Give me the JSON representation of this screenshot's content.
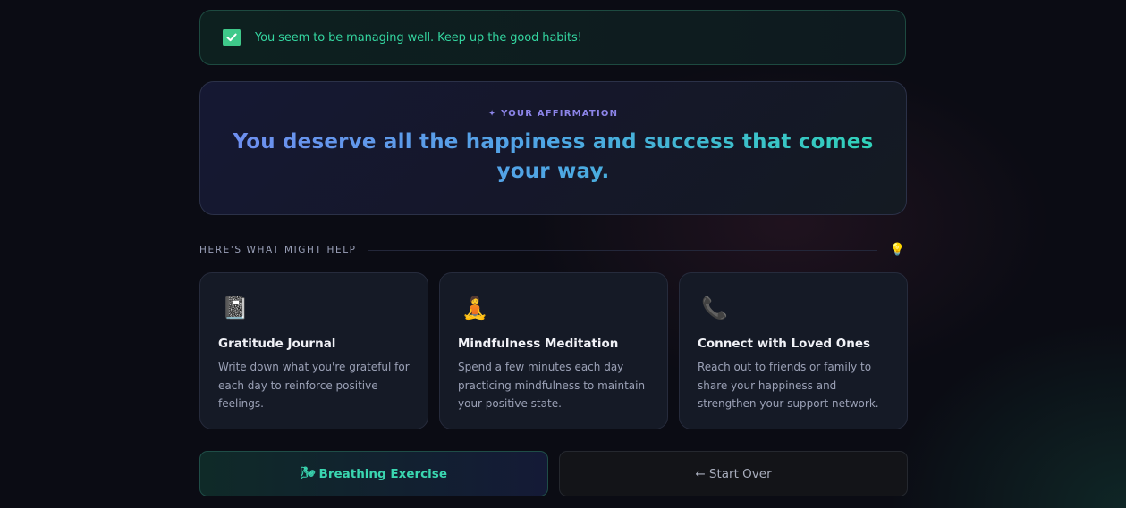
{
  "status": {
    "icon": "check-icon",
    "message": "You seem to be managing well. Keep up the good habits!"
  },
  "affirmation": {
    "label": "✦ YOUR AFFIRMATION",
    "text": "You deserve all the happiness and success that comes your way."
  },
  "help": {
    "title": "HERE'S WHAT MIGHT HELP",
    "icon": "💡",
    "cards": [
      {
        "icon": "📓",
        "icon_name": "journal-icon",
        "title": "Gratitude Journal",
        "description": "Write down what you're grateful for each day to reinforce positive feelings."
      },
      {
        "icon": "🧘",
        "icon_name": "meditation-icon",
        "title": "Mindfulness Meditation",
        "description": "Spend a few minutes each day practicing mindfulness to maintain your positive state."
      },
      {
        "icon": "📞",
        "icon_name": "phone-icon",
        "title": "Connect with Loved Ones",
        "description": "Reach out to friends or family to share your happiness and strengthen your support network."
      }
    ]
  },
  "actions": {
    "breathing_icon": "🌬",
    "breathing_label": "Breathing Exercise",
    "start_over_label": "← Start Over"
  },
  "colors": {
    "accent_green": "#34d6a0",
    "accent_purple": "#8c84e8",
    "background": "#0b0c14"
  }
}
